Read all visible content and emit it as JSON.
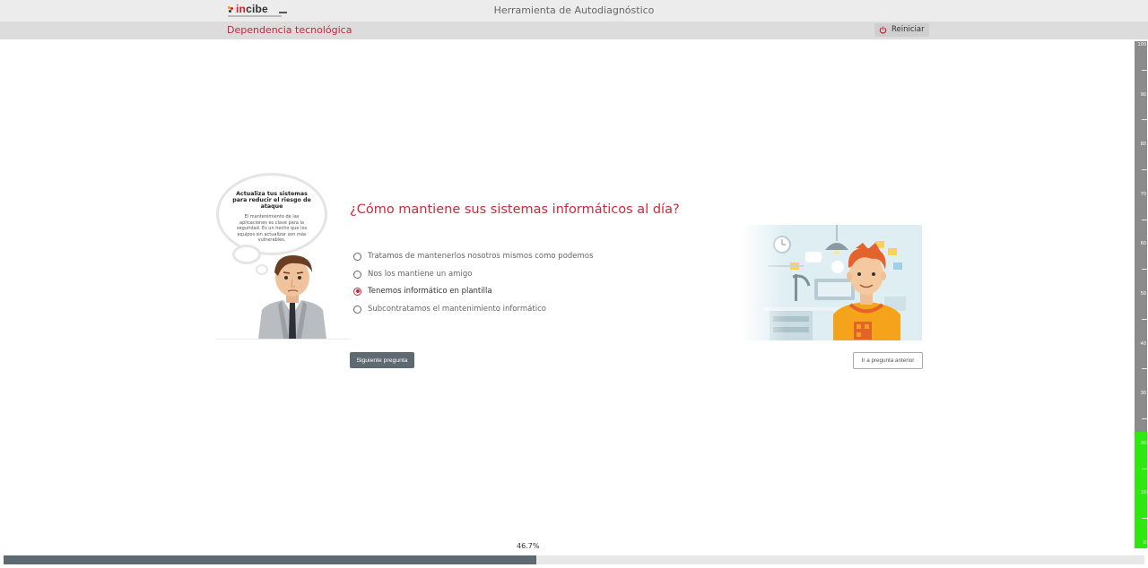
{
  "header": {
    "logo_text": "incibe",
    "app_title": "Herramienta de Autodiagnóstico"
  },
  "subheader": {
    "section_title": "Dependencia tecnológica",
    "restart_label": "Reiniciar"
  },
  "tip": {
    "title": "Actualiza tus sistemas para reducir el riesgo de ataque",
    "body": "El mantenimiento de las aplicaciones es clave para la seguridad. Es un hecho que los equipos sin actualizar son más vulnerables."
  },
  "question": {
    "text": "¿Cómo mantiene sus sistemas informáticos al día?",
    "options": [
      {
        "label": "Tratamos de mantenerlos nosotros mismos como podemos",
        "selected": false
      },
      {
        "label": "Nos los mantiene un amigo",
        "selected": false
      },
      {
        "label": "Tenemos informático en plantilla",
        "selected": true
      },
      {
        "label": "Subcontratamos el mantenimiento informático",
        "selected": false
      }
    ]
  },
  "buttons": {
    "next_label": "Siguiente pregunta",
    "prev_label": "Ir a pregunta anterior"
  },
  "gauge": {
    "value": 23,
    "labels": [
      "100",
      "90",
      "80",
      "70",
      "60",
      "50",
      "40",
      "30",
      "20",
      "10",
      "0"
    ],
    "fill_color": "#2ee80f",
    "empty_color": "#8c8c8c"
  },
  "progress": {
    "label": "46.7%",
    "value": 46.7
  },
  "colors": {
    "accent": "#c8253b",
    "button": "#5e6a72"
  }
}
